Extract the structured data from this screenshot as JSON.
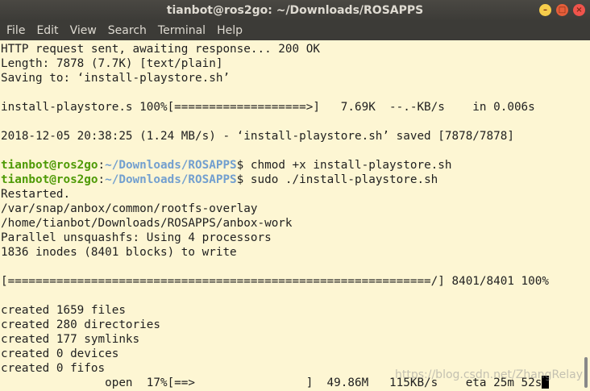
{
  "window": {
    "title": "tianbot@ros2go: ~/Downloads/ROSAPPS"
  },
  "menu": [
    "File",
    "Edit",
    "View",
    "Search",
    "Terminal",
    "Help"
  ],
  "terminal": {
    "lines": [
      "HTTP request sent, awaiting response... 200 OK",
      "Length: 7878 (7.7K) [text/plain]",
      "Saving to: ‘install-playstore.sh’",
      "",
      "install-playstore.s 100%[===================>]   7.69K  --.-KB/s    in 0.006s",
      "",
      "2018-12-05 20:38:25 (1.24 MB/s) - ‘install-playstore.sh’ saved [7878/7878]",
      "",
      {
        "user": "tianbot@ros2go",
        "sep": ":",
        "path": "~/Downloads/ROSAPPS",
        "cmd": "$ chmod +x install-playstore.sh"
      },
      {
        "user": "tianbot@ros2go",
        "sep": ":",
        "path": "~/Downloads/ROSAPPS",
        "cmd": "$ sudo ./install-playstore.sh"
      },
      "Restarted.",
      "/var/snap/anbox/common/rootfs-overlay",
      "/home/tianbot/Downloads/ROSAPPS/anbox-work",
      "Parallel unsquashfs: Using 4 processors",
      "1836 inodes (8401 blocks) to write",
      "",
      "[=============================================================/] 8401/8401 100%",
      "",
      "created 1659 files",
      "created 280 directories",
      "created 177 symlinks",
      "created 0 devices",
      "created 0 fifos",
      "               open  17%[==>                ]  49.86M   115KB/s    eta 25m 52s"
    ]
  },
  "watermark": "https://blog.csdn.net/ZhangRelay"
}
